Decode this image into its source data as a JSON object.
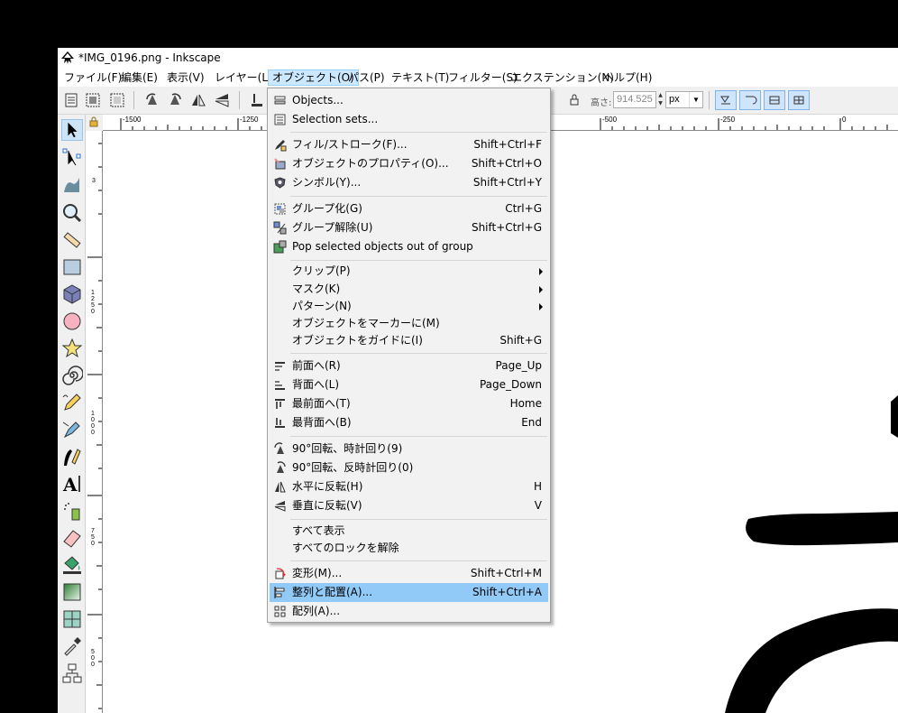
{
  "window": {
    "title": "*IMG_0196.png - Inkscape"
  },
  "menubar": {
    "items": [
      {
        "label": "ファイル(F)"
      },
      {
        "label": "編集(E)"
      },
      {
        "label": "表示(V)"
      },
      {
        "label": "レイヤー(L)"
      },
      {
        "label": "オブジェクト(O)"
      },
      {
        "label": "パス(P)"
      },
      {
        "label": "テキスト(T)"
      },
      {
        "label": "フィルター(S)"
      },
      {
        "label": "エクステンション(N)"
      },
      {
        "label": "ヘルプ(H)"
      }
    ],
    "active": "オブジェクト(O)"
  },
  "toolbar": {
    "height_label": "高さ:",
    "height_value": "914.525",
    "unit": "px"
  },
  "ruler": {
    "h_labels": [
      "-1500",
      "-1250",
      "-500",
      "-250",
      "0"
    ],
    "v_labels": [
      "3",
      "1250",
      "1000",
      "750",
      "500"
    ]
  },
  "object_menu": {
    "items": [
      {
        "label": "Objects...",
        "shortcut": "",
        "icon": "objects-icon"
      },
      {
        "label": "Selection sets...",
        "shortcut": "",
        "icon": "selection-sets-icon"
      },
      {
        "label": "フィル/ストローク(F)...",
        "shortcut": "Shift+Ctrl+F",
        "icon": "fill-stroke-icon"
      },
      {
        "label": "オブジェクトのプロパティ(O)...",
        "shortcut": "Shift+Ctrl+O",
        "icon": "object-properties-icon"
      },
      {
        "label": "シンボル(Y)...",
        "shortcut": "Shift+Ctrl+Y",
        "icon": "symbols-icon"
      },
      {
        "label": "グループ化(G)",
        "shortcut": "Ctrl+G",
        "icon": "group-icon"
      },
      {
        "label": "グループ解除(U)",
        "shortcut": "Shift+Ctrl+G",
        "icon": "ungroup-icon"
      },
      {
        "label": "Pop selected objects out of group",
        "shortcut": "",
        "icon": "pop-out-group-icon"
      },
      {
        "label": "クリップ(P)",
        "shortcut": "",
        "submenu": true
      },
      {
        "label": "マスク(K)",
        "shortcut": "",
        "submenu": true
      },
      {
        "label": "パターン(N)",
        "shortcut": "",
        "submenu": true
      },
      {
        "label": "オブジェクトをマーカーに(M)",
        "shortcut": ""
      },
      {
        "label": "オブジェクトをガイドに(I)",
        "shortcut": "Shift+G"
      },
      {
        "label": "前面へ(R)",
        "shortcut": "Page_Up",
        "icon": "raise-icon"
      },
      {
        "label": "背面へ(L)",
        "shortcut": "Page_Down",
        "icon": "lower-icon"
      },
      {
        "label": "最前面へ(T)",
        "shortcut": "Home",
        "icon": "raise-to-top-icon"
      },
      {
        "label": "最背面へ(B)",
        "shortcut": "End",
        "icon": "lower-to-bottom-icon"
      },
      {
        "label": "90°回転、時計回り(9)",
        "shortcut": "",
        "icon": "rotate-cw-icon"
      },
      {
        "label": "90°回転、反時計回り(0)",
        "shortcut": "",
        "icon": "rotate-ccw-icon"
      },
      {
        "label": "水平に反転(H)",
        "shortcut": "H",
        "icon": "flip-horizontal-icon"
      },
      {
        "label": "垂直に反転(V)",
        "shortcut": "V",
        "icon": "flip-vertical-icon"
      },
      {
        "label": "すべて表示",
        "shortcut": ""
      },
      {
        "label": "すべてのロックを解除",
        "shortcut": ""
      },
      {
        "label": "変形(M)...",
        "shortcut": "Shift+Ctrl+M",
        "icon": "transform-icon"
      },
      {
        "label": "整列と配置(A)...",
        "shortcut": "Shift+Ctrl+A",
        "icon": "align-distribute-icon",
        "highlighted": true
      },
      {
        "label": "配列(A)...",
        "shortcut": "",
        "icon": "arrange-icon"
      }
    ]
  },
  "colors": {
    "menu_highlight": "#91c9f7",
    "menubar_active": "#cce8ff",
    "accent": "#0078d7"
  }
}
